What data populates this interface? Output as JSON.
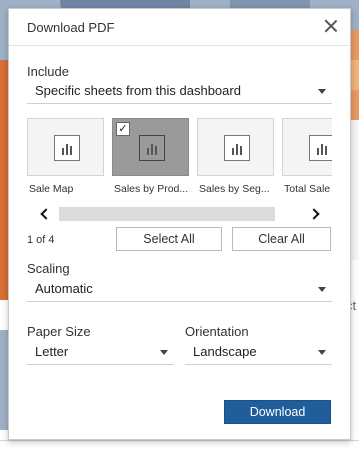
{
  "dialog": {
    "title": "Download PDF",
    "close_icon": "close-icon"
  },
  "include": {
    "label": "Include",
    "value": "Specific sheets from this dashboard"
  },
  "sheets": [
    {
      "label": "Sale Map",
      "selected": false,
      "icon": "bar-chart-icon"
    },
    {
      "label": "Sales by Prod...",
      "selected": true,
      "icon": "bar-chart-icon"
    },
    {
      "label": "Sales by Seg...",
      "selected": false,
      "icon": "bar-chart-icon"
    },
    {
      "label": "Total Sale",
      "selected": false,
      "icon": "bar-chart-icon"
    }
  ],
  "selection": {
    "count_text": "1 of 4",
    "select_all_label": "Select All",
    "clear_all_label": "Clear All",
    "check_glyph": "✓"
  },
  "scaling": {
    "label": "Scaling",
    "value": "Automatic"
  },
  "paper_size": {
    "label": "Paper Size",
    "value": "Letter"
  },
  "orientation": {
    "label": "Orientation",
    "value": "Landscape"
  },
  "download_label": "Download",
  "background": {
    "peek_text": "ct"
  },
  "colors": {
    "primary": "#1f5d9b",
    "selected_thumb": "#9a9a9a"
  }
}
